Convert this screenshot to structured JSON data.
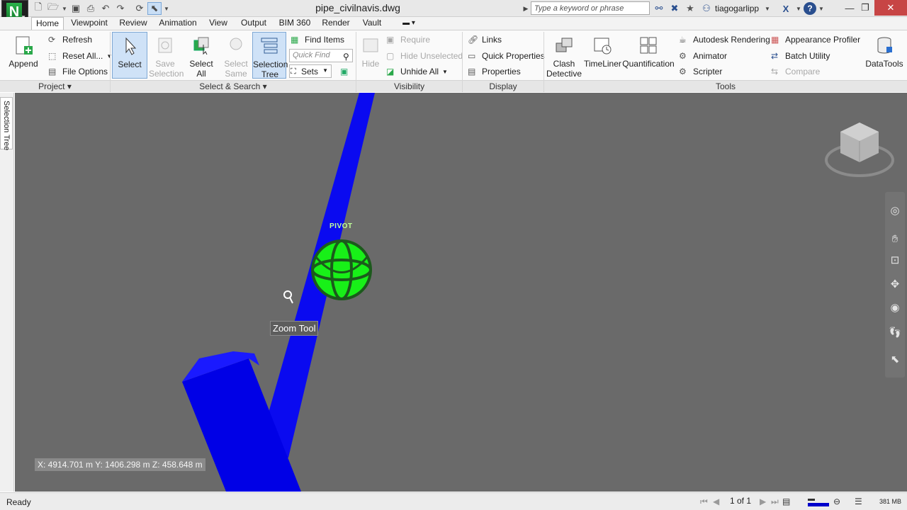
{
  "titlebar": {
    "file_title": "pipe_civilnavis.dwg",
    "search_placeholder": "Type a keyword or phrase",
    "user_name": "tiagogarlipp",
    "help_label": "?"
  },
  "tabs": [
    "Home",
    "Viewpoint",
    "Review",
    "Animation",
    "View",
    "Output",
    "BIM 360",
    "Render",
    "Vault"
  ],
  "active_tab": "Home",
  "ribbon": {
    "project": {
      "append_label": "Append",
      "refresh_label": "Refresh",
      "reset_all_label": "Reset All...",
      "file_options_label": "File Options",
      "panel_title": "Project"
    },
    "select_search": {
      "select_label": "Select",
      "save_selection_label": "Save Selection",
      "select_all_label": "Select All",
      "select_same_label": "Select Same",
      "selection_tree_label": "Selection Tree",
      "find_items_label": "Find Items",
      "quick_find_placeholder": "Quick Find",
      "sets_label": "Sets",
      "panel_title": "Select & Search"
    },
    "visibility": {
      "hide_label": "Hide",
      "require_label": "Require",
      "hide_unselected_label": "Hide Unselected",
      "unhide_all_label": "Unhide All",
      "panel_title": "Visibility"
    },
    "display": {
      "links_label": "Links",
      "quick_properties_label": "Quick Properties",
      "properties_label": "Properties",
      "panel_title": "Display"
    },
    "tools": {
      "clash_detective_label": "Clash Detective",
      "timeliner_label": "TimeLiner",
      "quantification_label": "Quantification",
      "autodesk_rendering_label": "Autodesk Rendering",
      "animator_label": "Animator",
      "scripter_label": "Scripter",
      "appearance_profiler_label": "Appearance Profiler",
      "batch_utility_label": "Batch Utility",
      "compare_label": "Compare",
      "datatools_label": "DataTools",
      "panel_title": "Tools"
    }
  },
  "left_dock": {
    "selection_tree_tab": "Selection Tree"
  },
  "viewport": {
    "pivot_label": "PIVOT",
    "tooltip": "Zoom Tool",
    "coordinates": "X: 4914.701 m   Y: 1406.298 m   Z: 458.648 m"
  },
  "statusbar": {
    "status_text": "Ready",
    "page_indicator": "1 of 1",
    "memory": "381 MB"
  },
  "colors": {
    "pipe": "#0000ff",
    "pivot_sphere": "#00ee00",
    "viewport_bg": "#6a6a6a",
    "accent": "#cfe2f7"
  }
}
